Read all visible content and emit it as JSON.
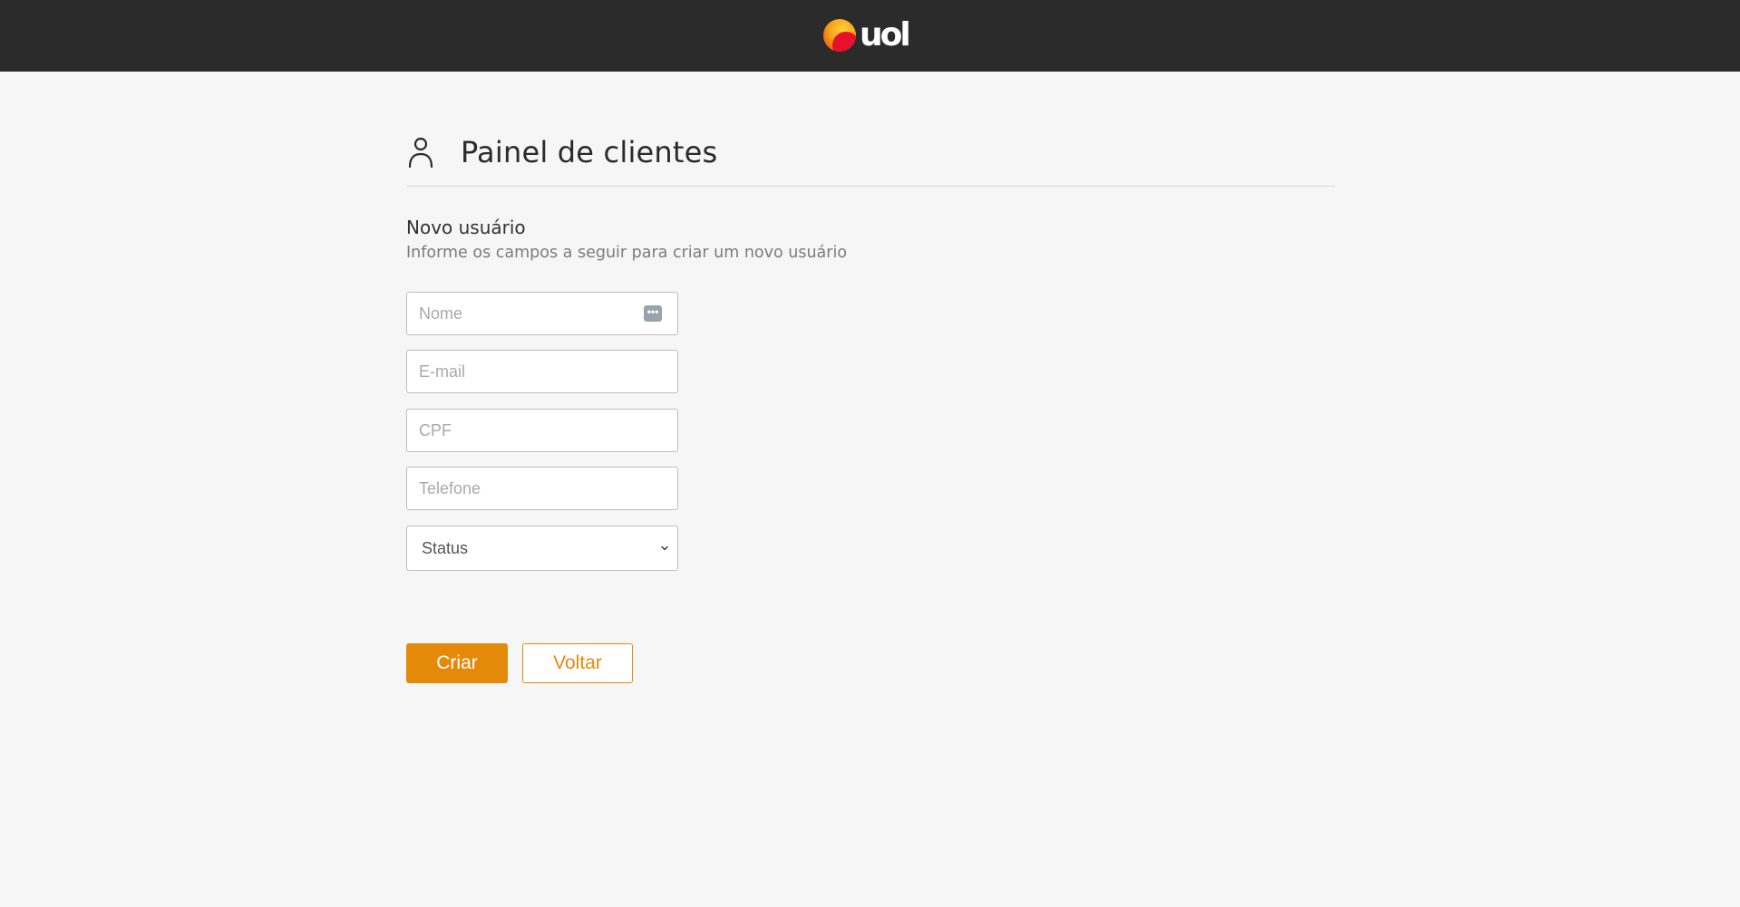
{
  "header": {
    "logo_text": "uol",
    "background": "#2b2b2b"
  },
  "page": {
    "title": "Painel de clientes",
    "title_icon": "user-icon"
  },
  "form": {
    "heading": "Novo usuário",
    "description": "Informe os campos a seguir para criar um novo usuário",
    "fields": {
      "name": {
        "placeholder": "Nome",
        "value": ""
      },
      "email": {
        "placeholder": "E-mail",
        "value": ""
      },
      "cpf": {
        "placeholder": "CPF",
        "value": ""
      },
      "phone": {
        "placeholder": "Telefone",
        "value": ""
      },
      "status": {
        "selected": "Status"
      }
    },
    "autofill_icon": "•••"
  },
  "actions": {
    "create_label": "Criar",
    "back_label": "Voltar"
  },
  "colors": {
    "accent": "#e5890a",
    "page_background": "#f6f6f6"
  }
}
